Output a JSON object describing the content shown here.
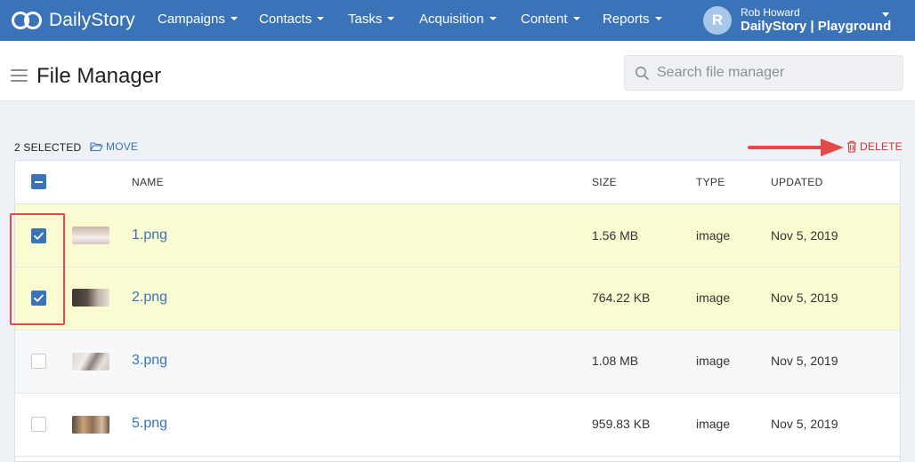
{
  "brand": {
    "name": "DailyStory"
  },
  "nav": {
    "items": [
      {
        "label": "Campaigns"
      },
      {
        "label": "Contacts"
      },
      {
        "label": "Tasks"
      },
      {
        "label": "Acquisition"
      },
      {
        "label": "Content"
      },
      {
        "label": "Reports"
      }
    ]
  },
  "user": {
    "initial": "R",
    "name": "Rob Howard",
    "org": "DailyStory | Playground"
  },
  "page": {
    "title": "File Manager"
  },
  "search": {
    "placeholder": "Search file manager",
    "value": ""
  },
  "toolbar": {
    "selected_label": "2 SELECTED",
    "move_label": "MOVE",
    "delete_label": "DELETE"
  },
  "table": {
    "headers": {
      "name": "NAME",
      "size": "SIZE",
      "type": "TYPE",
      "updated": "UPDATED"
    },
    "rows": [
      {
        "name": "1.png",
        "size": "1.56 MB",
        "type": "image",
        "updated": "Nov 5, 2019",
        "checked": true
      },
      {
        "name": "2.png",
        "size": "764.22 KB",
        "type": "image",
        "updated": "Nov 5, 2019",
        "checked": true
      },
      {
        "name": "3.png",
        "size": "1.08 MB",
        "type": "image",
        "updated": "Nov 5, 2019",
        "checked": false
      },
      {
        "name": "5.png",
        "size": "959.83 KB",
        "type": "image",
        "updated": "Nov 5, 2019",
        "checked": false
      }
    ]
  },
  "colors": {
    "nav_bg": "#3a73b8",
    "accent": "#3a73b8",
    "selected_row": "#fbfbd1",
    "delete": "#d0332e",
    "annotation": "#e5494a"
  },
  "icons": {
    "brand": "infinity-logo-icon",
    "menu": "hamburger-icon",
    "search": "search-icon",
    "move": "folder-open-icon",
    "delete": "trash-icon",
    "caret": "chevron-down-icon"
  }
}
